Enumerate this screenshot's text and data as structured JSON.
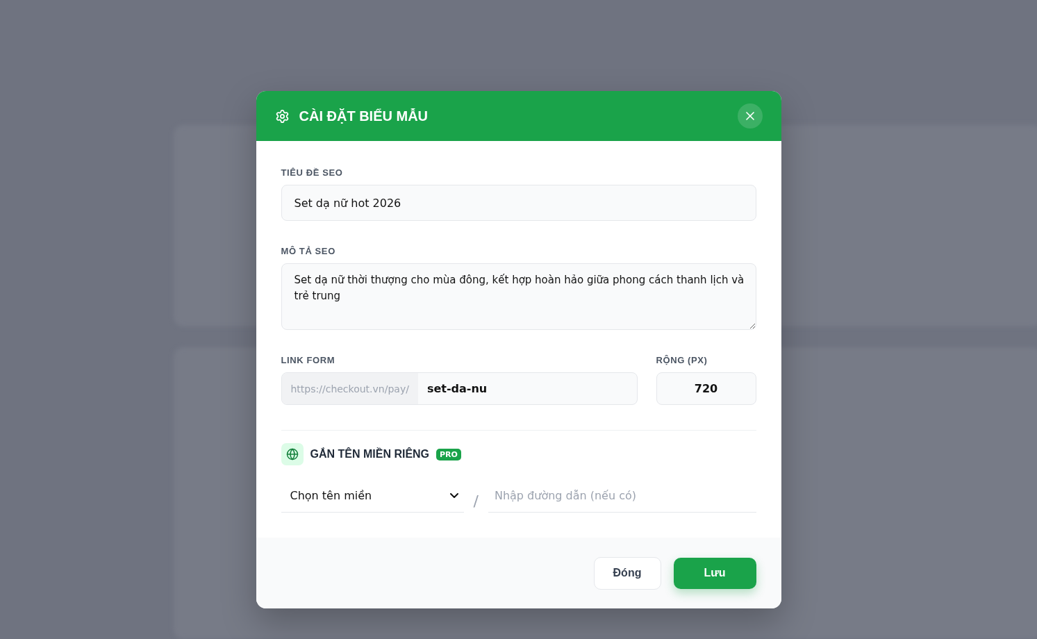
{
  "dialog": {
    "title": "CÀI ĐẶT BIỂU MẪU",
    "seo_title": {
      "label": "TIÊU ĐỀ SEO",
      "value": "Set dạ nữ hot 2026"
    },
    "seo_description": {
      "label": "MÔ TẢ SEO",
      "value": "Set dạ nữ thời thượng cho mùa đông, kết hợp hoàn hảo giữa phong cách thanh lịch và trẻ trung"
    },
    "link_form": {
      "label": "LINK FORM",
      "prefix": "https://checkout.vn/pay/",
      "value": "set-da-nu"
    },
    "width": {
      "label": "RỘNG (PX)",
      "value": "720"
    },
    "custom_domain": {
      "title": "GẮN TÊN MIỀN RIÊNG",
      "badge": "PRO",
      "domain_select": {
        "value": "Chọn tên miền"
      },
      "separator": "/",
      "path": {
        "placeholder": "Nhập đường dẫn (nếu có)"
      }
    },
    "buttons": [
      {
        "label": "Đóng",
        "kind": "secondary"
      },
      {
        "label": "Lưu",
        "kind": "primary"
      }
    ]
  }
}
